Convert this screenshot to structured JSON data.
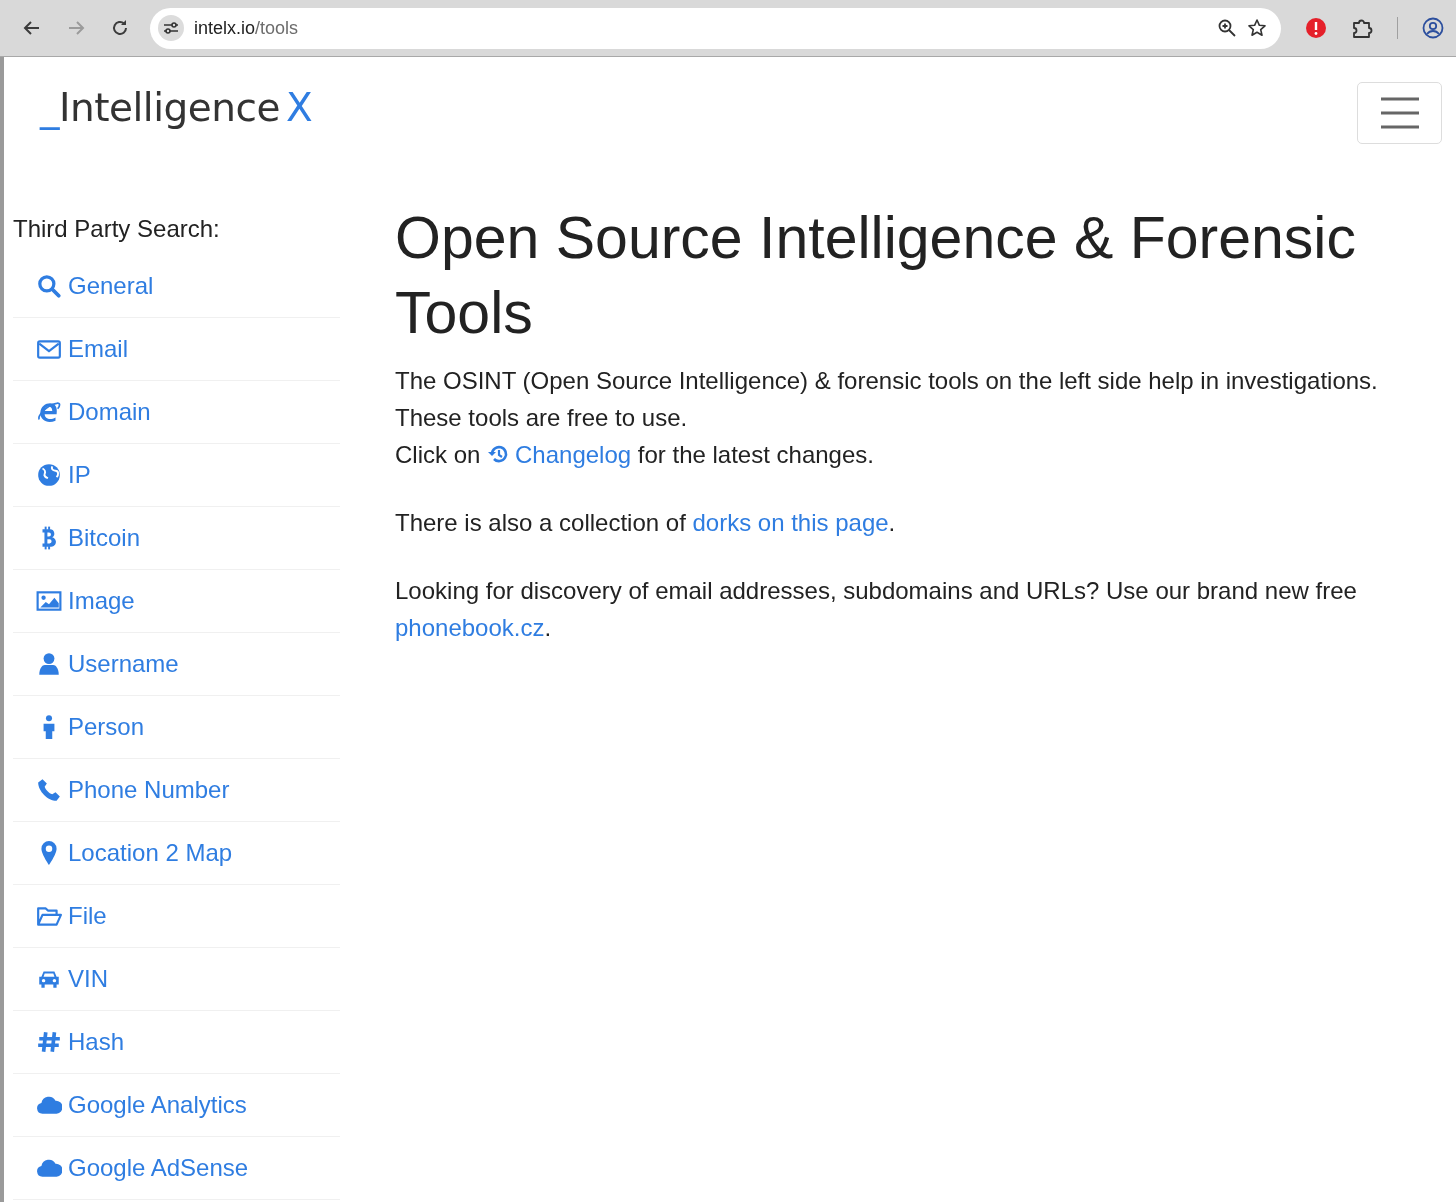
{
  "browser": {
    "forward_disabled": true,
    "url_host": "intelx.io",
    "url_path": "/tools"
  },
  "logo": {
    "prefix": "_",
    "name": "Intelligence",
    "suffix": "X"
  },
  "sidebar": {
    "heading": "Third Party Search:",
    "items": [
      {
        "label": "General",
        "kind": "search"
      },
      {
        "label": "Email",
        "kind": "envelope"
      },
      {
        "label": "Domain",
        "kind": "browser"
      },
      {
        "label": "IP",
        "kind": "globe"
      },
      {
        "label": "Bitcoin",
        "kind": "bitcoin"
      },
      {
        "label": "Image",
        "kind": "image"
      },
      {
        "label": "Username",
        "kind": "user"
      },
      {
        "label": "Person",
        "kind": "person"
      },
      {
        "label": "Phone Number",
        "kind": "phone"
      },
      {
        "label": "Location 2 Map",
        "kind": "pin"
      },
      {
        "label": "File",
        "kind": "folder"
      },
      {
        "label": "VIN",
        "kind": "car"
      },
      {
        "label": "Hash",
        "kind": "hash"
      },
      {
        "label": "Google Analytics",
        "kind": "cloud"
      },
      {
        "label": "Google AdSense",
        "kind": "cloud"
      }
    ]
  },
  "main": {
    "title": "Open Source Intelligence & Forensic Tools",
    "intro_lines": [
      "The OSINT (Open Source Intelligence) & forensic tools on the left side help in investigations.",
      "These tools are free to use."
    ],
    "changelog": {
      "before": "Click on ",
      "link": "Changelog",
      "after": " for the latest changes."
    },
    "dorks": {
      "before": "There is also a collection of ",
      "link": "dorks on this page",
      "after": "."
    },
    "phonebook": {
      "before": "Looking for discovery of email addresses, subdomains and URLs? Use our brand new free ",
      "link": "phonebook.cz",
      "after": "."
    }
  }
}
